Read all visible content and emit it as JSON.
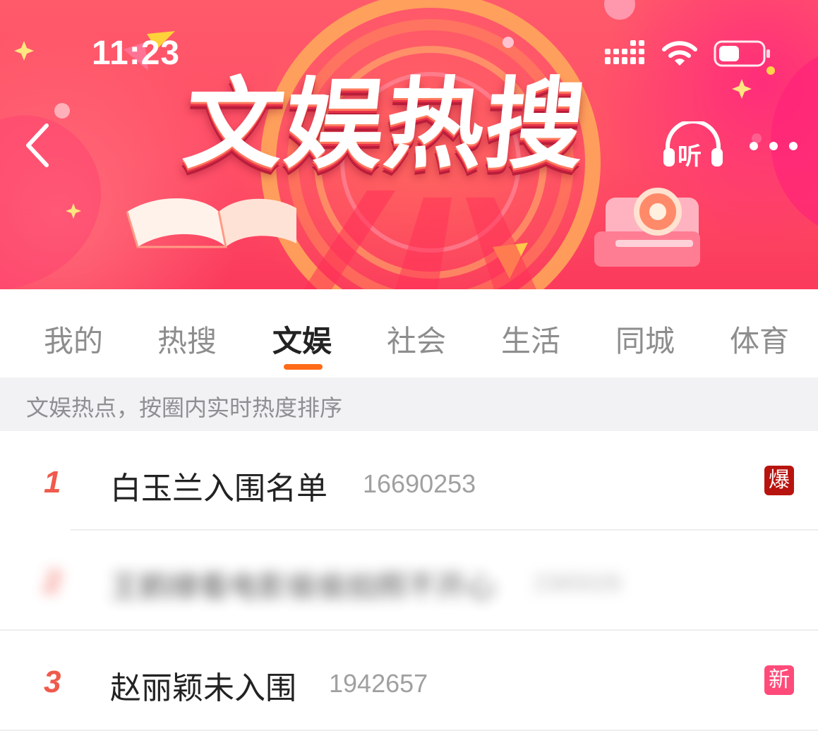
{
  "status_bar": {
    "time": "11:23"
  },
  "banner": {
    "title": "文娱热搜",
    "listen_label": "听"
  },
  "tabs": [
    {
      "label": "我的",
      "active": false
    },
    {
      "label": "热搜",
      "active": false
    },
    {
      "label": "文娱",
      "active": true
    },
    {
      "label": "社会",
      "active": false
    },
    {
      "label": "生活",
      "active": false
    },
    {
      "label": "同城",
      "active": false
    },
    {
      "label": "体育",
      "active": false
    }
  ],
  "info": {
    "text": "文娱热点，按圈内实时热度排序"
  },
  "list": [
    {
      "rank": "1",
      "title": "白玉兰入围名单",
      "count": "16690253",
      "badge": "爆",
      "badge_color": "#b8140f",
      "blurred": false
    },
    {
      "rank": "2",
      "title": "王鹤棣看电影偷偷拍照不开心",
      "count": "2365026",
      "badge": "",
      "badge_color": "",
      "blurred": true
    },
    {
      "rank": "3",
      "title": "赵丽颖未入围",
      "count": "1942657",
      "badge": "新",
      "badge_color": "#ff4b79",
      "blurred": false
    }
  ],
  "colors": {
    "accent": "#ff6b17",
    "rank": "#f05a4c",
    "banner": "#ff4d67"
  },
  "icons": [
    "back-arrow-icon",
    "headphones-icon",
    "more-dots-icon",
    "signal-icon",
    "wifi-icon",
    "battery-icon"
  ]
}
